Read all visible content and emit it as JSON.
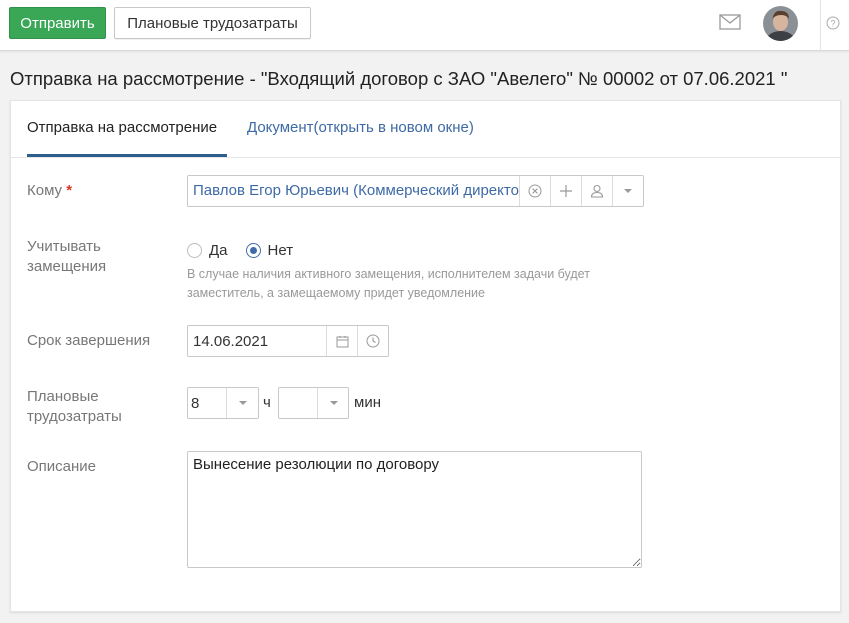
{
  "toolbar": {
    "send_label": "Отправить",
    "plan_label": "Плановые трудозатраты",
    "mail_icon": "mail-icon",
    "help_icon": "help-icon"
  },
  "page": {
    "title": "Отправка на рассмотрение - \"Входящий договор с ЗАО \"Авелего\" № 00002 от 07.06.2021 \""
  },
  "tabs": [
    {
      "label": "Отправка на рассмотрение",
      "active": true
    },
    {
      "label": "Документ(открыть в новом окне)",
      "active": false
    }
  ],
  "form": {
    "recipient": {
      "label": "Кому",
      "required_mark": "*",
      "value": "Павлов Егор Юрьевич (Коммерческий директор)",
      "icons": [
        "clear-icon",
        "plus-icon",
        "user-icon",
        "dropdown-icon"
      ]
    },
    "substitution": {
      "label_line1": "Учитывать",
      "label_line2": "замещения",
      "options": [
        "Да",
        "Нет"
      ],
      "selected": "Нет",
      "hint": "В случае наличия активного замещения, исполнителем задачи будет заместитель, а замещаемому придет уведомление"
    },
    "due_date": {
      "label": "Срок завершения",
      "value": "14.06.2021",
      "icons": [
        "calendar-icon",
        "clock-icon"
      ]
    },
    "planned_effort": {
      "label_line1": "Плановые",
      "label_line2": "трудозатраты",
      "hours_value": "8",
      "hours_unit": "ч",
      "minutes_value": "",
      "minutes_unit": "мин"
    },
    "description": {
      "label": "Описание",
      "value": "Вынесение резолюции по договору"
    }
  },
  "colors": {
    "accent_green": "#3aa757",
    "link_blue": "#3e6aa6",
    "tab_underline": "#2f5e8e",
    "required_red": "#d9342b"
  }
}
